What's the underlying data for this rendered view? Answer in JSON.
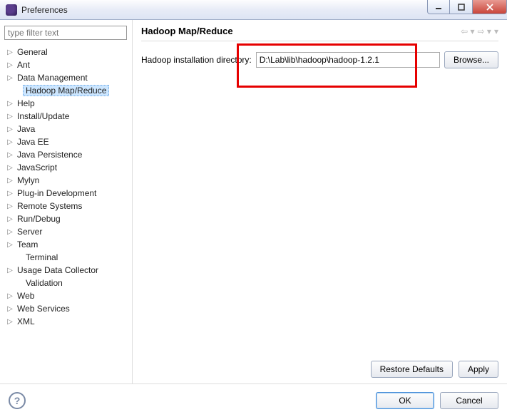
{
  "window": {
    "title": "Preferences"
  },
  "sidebar": {
    "filter_placeholder": "type filter text",
    "items": [
      {
        "label": "General",
        "expandable": true
      },
      {
        "label": "Ant",
        "expandable": true
      },
      {
        "label": "Data Management",
        "expandable": true
      },
      {
        "label": "Hadoop Map/Reduce",
        "expandable": false,
        "selected": true,
        "indent": true
      },
      {
        "label": "Help",
        "expandable": true
      },
      {
        "label": "Install/Update",
        "expandable": true
      },
      {
        "label": "Java",
        "expandable": true
      },
      {
        "label": "Java EE",
        "expandable": true
      },
      {
        "label": "Java Persistence",
        "expandable": true
      },
      {
        "label": "JavaScript",
        "expandable": true
      },
      {
        "label": "Mylyn",
        "expandable": true
      },
      {
        "label": "Plug-in Development",
        "expandable": true
      },
      {
        "label": "Remote Systems",
        "expandable": true
      },
      {
        "label": "Run/Debug",
        "expandable": true
      },
      {
        "label": "Server",
        "expandable": true
      },
      {
        "label": "Team",
        "expandable": true
      },
      {
        "label": "Terminal",
        "expandable": false,
        "indent": true
      },
      {
        "label": "Usage Data Collector",
        "expandable": true
      },
      {
        "label": "Validation",
        "expandable": false,
        "indent": true
      },
      {
        "label": "Web",
        "expandable": true
      },
      {
        "label": "Web Services",
        "expandable": true
      },
      {
        "label": "XML",
        "expandable": true
      }
    ]
  },
  "main": {
    "heading": "Hadoop Map/Reduce",
    "field_label": "Hadoop installation directory:",
    "field_value": "D:\\Lab\\lib\\hadoop\\hadoop-1.2.1",
    "browse_label": "Browse...",
    "restore_label": "Restore Defaults",
    "apply_label": "Apply"
  },
  "footer": {
    "ok_label": "OK",
    "cancel_label": "Cancel"
  }
}
